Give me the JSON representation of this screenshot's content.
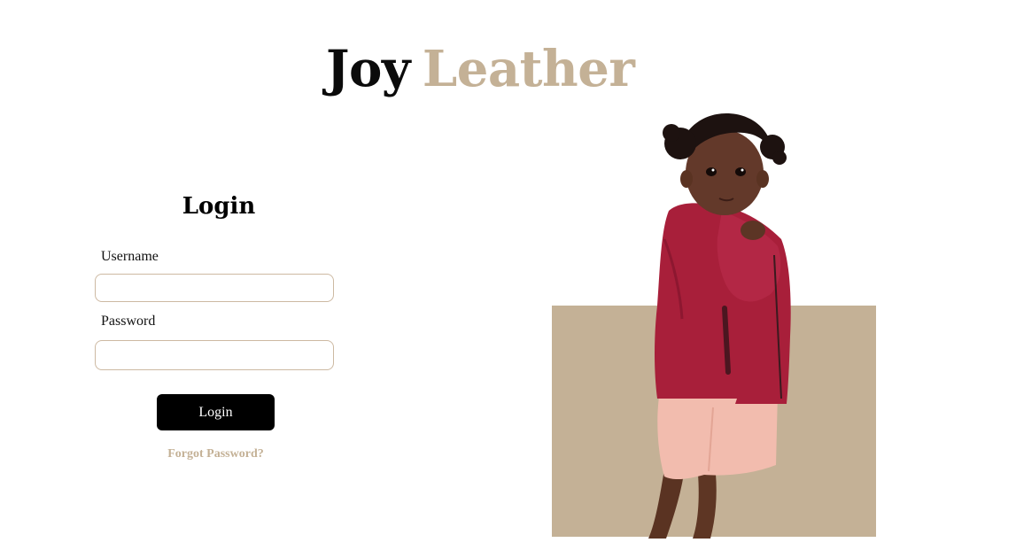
{
  "brand": {
    "word1": "Joy",
    "word2": "Leather",
    "color_dark": "#0b0b0b",
    "color_accent": "#c4b196"
  },
  "login": {
    "title": "Login",
    "username_label": "Username",
    "username_value": "",
    "password_label": "Password",
    "password_value": "",
    "button_label": "Login",
    "forgot_label": "Forgot Password?"
  },
  "hero": {
    "backdrop_color": "#c4b196",
    "jacket_color": "#a81f3a",
    "shorts_color": "#f2bcae"
  }
}
